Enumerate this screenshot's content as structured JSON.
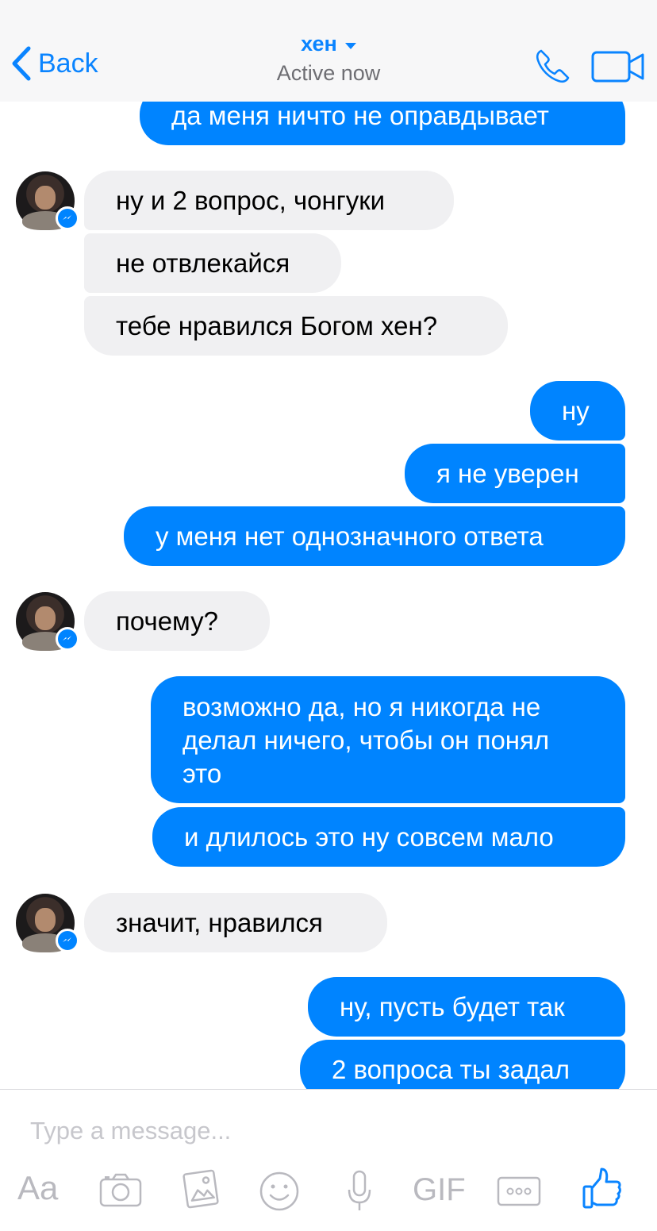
{
  "header": {
    "back_label": "Back",
    "contact_name": "хен",
    "status": "Active now"
  },
  "messages": [
    {
      "side": "out",
      "text": "да меня ничто не оправдывает"
    },
    {
      "side": "in",
      "text": "ну и 2 вопрос, чонгуки"
    },
    {
      "side": "in",
      "text": "не отвлекайся"
    },
    {
      "side": "in",
      "text": "тебе нравился Богом хен?"
    },
    {
      "side": "out",
      "text": "ну"
    },
    {
      "side": "out",
      "text": "я не уверен"
    },
    {
      "side": "out",
      "text": "у меня нет однозначного ответа"
    },
    {
      "side": "in",
      "text": "почему?"
    },
    {
      "side": "out",
      "text": "возможно да, но я никогда не делал ничего, чтобы он понял это"
    },
    {
      "side": "out",
      "text": "и длилось это ну совсем мало"
    },
    {
      "side": "in",
      "text": "значит, нравился"
    },
    {
      "side": "out",
      "text": "ну, пусть будет так"
    },
    {
      "side": "out",
      "text": "2 вопроса ты задал"
    }
  ],
  "composer": {
    "placeholder": "Type a message...",
    "text_tool_label": "Aa",
    "gif_label": "GIF"
  },
  "icons": {
    "back": "chevron-left-icon",
    "call": "phone-icon",
    "video": "video-camera-icon",
    "camera": "camera-icon",
    "gallery": "image-gallery-icon",
    "emoji": "emoji-icon",
    "mic": "microphone-icon",
    "more": "more-icon",
    "like": "thumbs-up-icon"
  },
  "colors": {
    "accent": "#0084ff",
    "outgoing_bubble": "#0084ff",
    "incoming_bubble": "#f0f0f2",
    "toolbar_icon": "#b9b9bf"
  }
}
